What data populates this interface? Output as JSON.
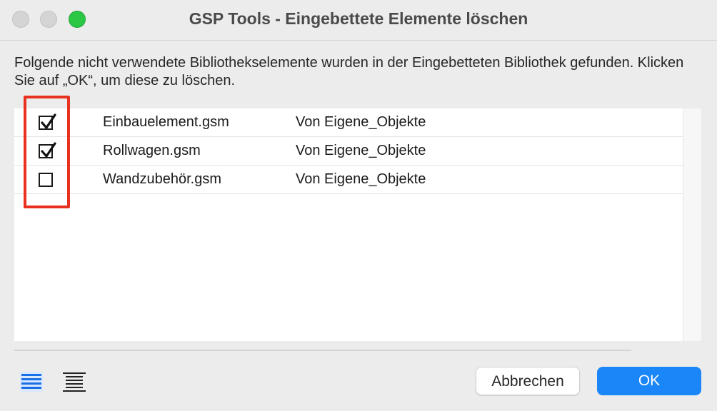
{
  "window": {
    "title": "GSP Tools - Eingebettete Elemente löschen"
  },
  "message": "Folgende nicht verwendete Bibliothekselemente wurden in der Eingebetteten Bibliothek gefunden. Klicken Sie auf „OK“, um diese zu löschen.",
  "items": [
    {
      "checked": true,
      "name": "Einbauelement.gsm",
      "source": "Von Eigene_Objekte"
    },
    {
      "checked": true,
      "name": "Rollwagen.gsm",
      "source": "Von Eigene_Objekte"
    },
    {
      "checked": false,
      "name": "Wandzubehör.gsm",
      "source": "Von Eigene_Objekte"
    }
  ],
  "buttons": {
    "cancel_label": "Abbrechen",
    "ok_label": "OK"
  },
  "icons": {
    "view_list": "list-view-icon",
    "view_compact": "compact-list-view-icon"
  },
  "colors": {
    "accent": "#1a86f7",
    "highlight": "#e8321f",
    "zoom_button": "#2ac845"
  }
}
